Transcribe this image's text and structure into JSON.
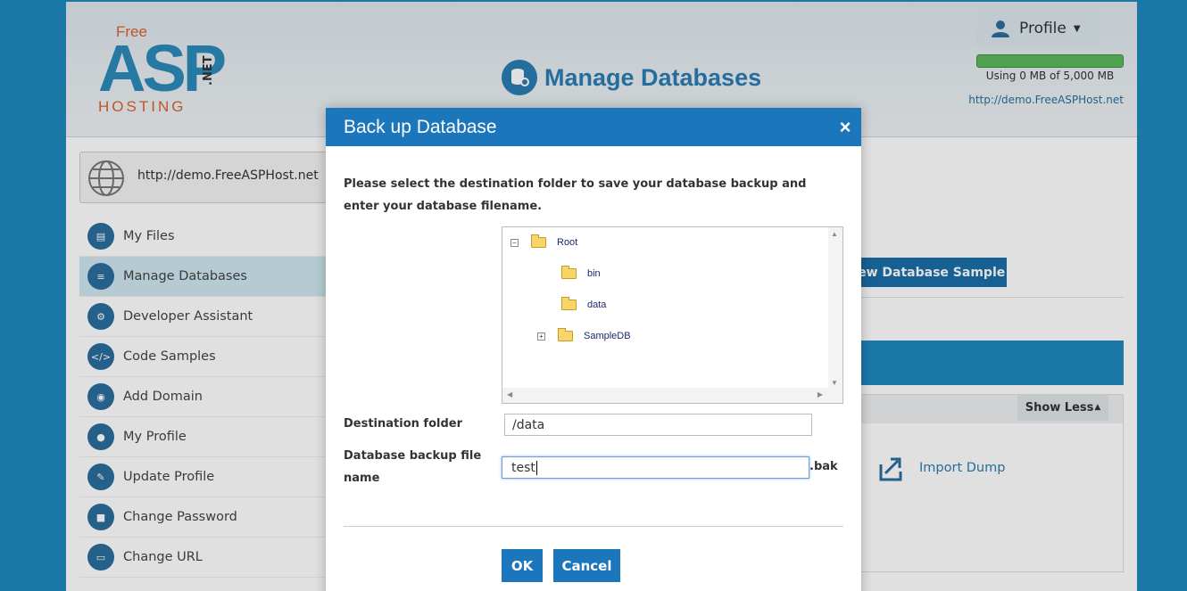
{
  "logo": {
    "free": "Free",
    "asp": "ASP",
    "hosting": "HOSTING",
    "net": ".NET"
  },
  "header": {
    "title": "Manage Databases",
    "profile_label": "Profile",
    "usage_text": "Using 0 MB of 5,000 MB",
    "usage_fraction": 0.0,
    "site_link": "http://demo.FreeASPHost.net"
  },
  "url_box": {
    "url": "http://demo.FreeASPHost.net"
  },
  "sidebar": {
    "items": [
      {
        "label": "My Files",
        "icon": "files-icon"
      },
      {
        "label": "Manage Databases",
        "icon": "database-icon",
        "active": true
      },
      {
        "label": "Developer Assistant",
        "icon": "head-gear-icon"
      },
      {
        "label": "Code Samples",
        "icon": "code-icon"
      },
      {
        "label": "Add Domain",
        "icon": "www-icon"
      },
      {
        "label": "My Profile",
        "icon": "user-icon"
      },
      {
        "label": "Update Profile",
        "icon": "user-edit-icon"
      },
      {
        "label": "Change Password",
        "icon": "lock-icon"
      },
      {
        "label": "Change URL",
        "icon": "url-icon"
      }
    ]
  },
  "main": {
    "view_sample_label": "View Database Sample",
    "show_less_label": "Show Less",
    "import_dump_label": "Import Dump"
  },
  "modal": {
    "title": "Back up Database",
    "close_glyph": "×",
    "instructions": "Please select the destination folder to save your database backup and enter your database filename.",
    "tree": {
      "root": "Root",
      "children": [
        "bin",
        "data",
        "SampleDB"
      ],
      "expander_collapse": "−",
      "expander_expand": "+"
    },
    "destination_label": "Destination folder",
    "destination_value": "/data",
    "filename_label": "Database backup file name",
    "filename_value": "test",
    "filename_suffix": ".bak",
    "ok_label": "OK",
    "cancel_label": "Cancel"
  },
  "colors": {
    "accent": "#1c76bc",
    "page_bg": "#1f88be",
    "usage_bar": "#5cb85c"
  }
}
